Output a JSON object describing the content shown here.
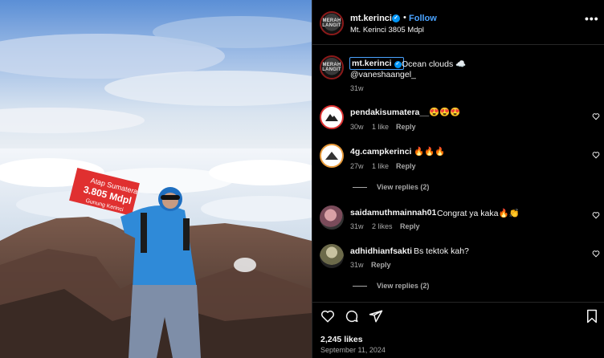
{
  "post": {
    "account": "mt.kerinci",
    "follow_label": "Follow",
    "location": "Mt. Kerinci 3805 Mdpl",
    "more_label": "•••",
    "dot": "•",
    "avatar_logo_text": "MERAH LANGIT",
    "photo_sign": {
      "line1": "Atap Sumatera",
      "line2": "3.805 Mdpl",
      "line3": "Gunung Kerinci"
    }
  },
  "caption": {
    "username": "mt.kerinci",
    "text": "Ocean clouds ☁️",
    "mention": "@vaneshaangel_",
    "time": "31w"
  },
  "comments": [
    {
      "username": "pendakisumatera__",
      "text": "😍😍😍",
      "time": "30w",
      "likes": "1 like",
      "reply": "Reply"
    },
    {
      "username": "4g.campkerinci",
      "text": "🔥🔥🔥",
      "time": "27w",
      "likes": "1 like",
      "reply": "Reply",
      "view_replies": "View replies (2)"
    },
    {
      "username": "saidamuthmainnah01",
      "text": "Congrat ya kaka🔥👏",
      "time": "31w",
      "likes": "2 likes",
      "reply": "Reply"
    },
    {
      "username": "adhidhianfsakti",
      "text": "Bs tektok kah?",
      "time": "31w",
      "reply": "Reply",
      "view_replies": "View replies (2)"
    }
  ],
  "footer": {
    "likes": "2,245 likes",
    "date": "September 11, 2024"
  },
  "icons": {
    "like": "heart-icon",
    "comment": "comment-icon",
    "share": "share-icon",
    "save": "bookmark-icon"
  },
  "colors": {
    "background": "#000000",
    "link": "#4aa3ff",
    "verified": "#0095f6",
    "muted": "#a8a8a8"
  }
}
